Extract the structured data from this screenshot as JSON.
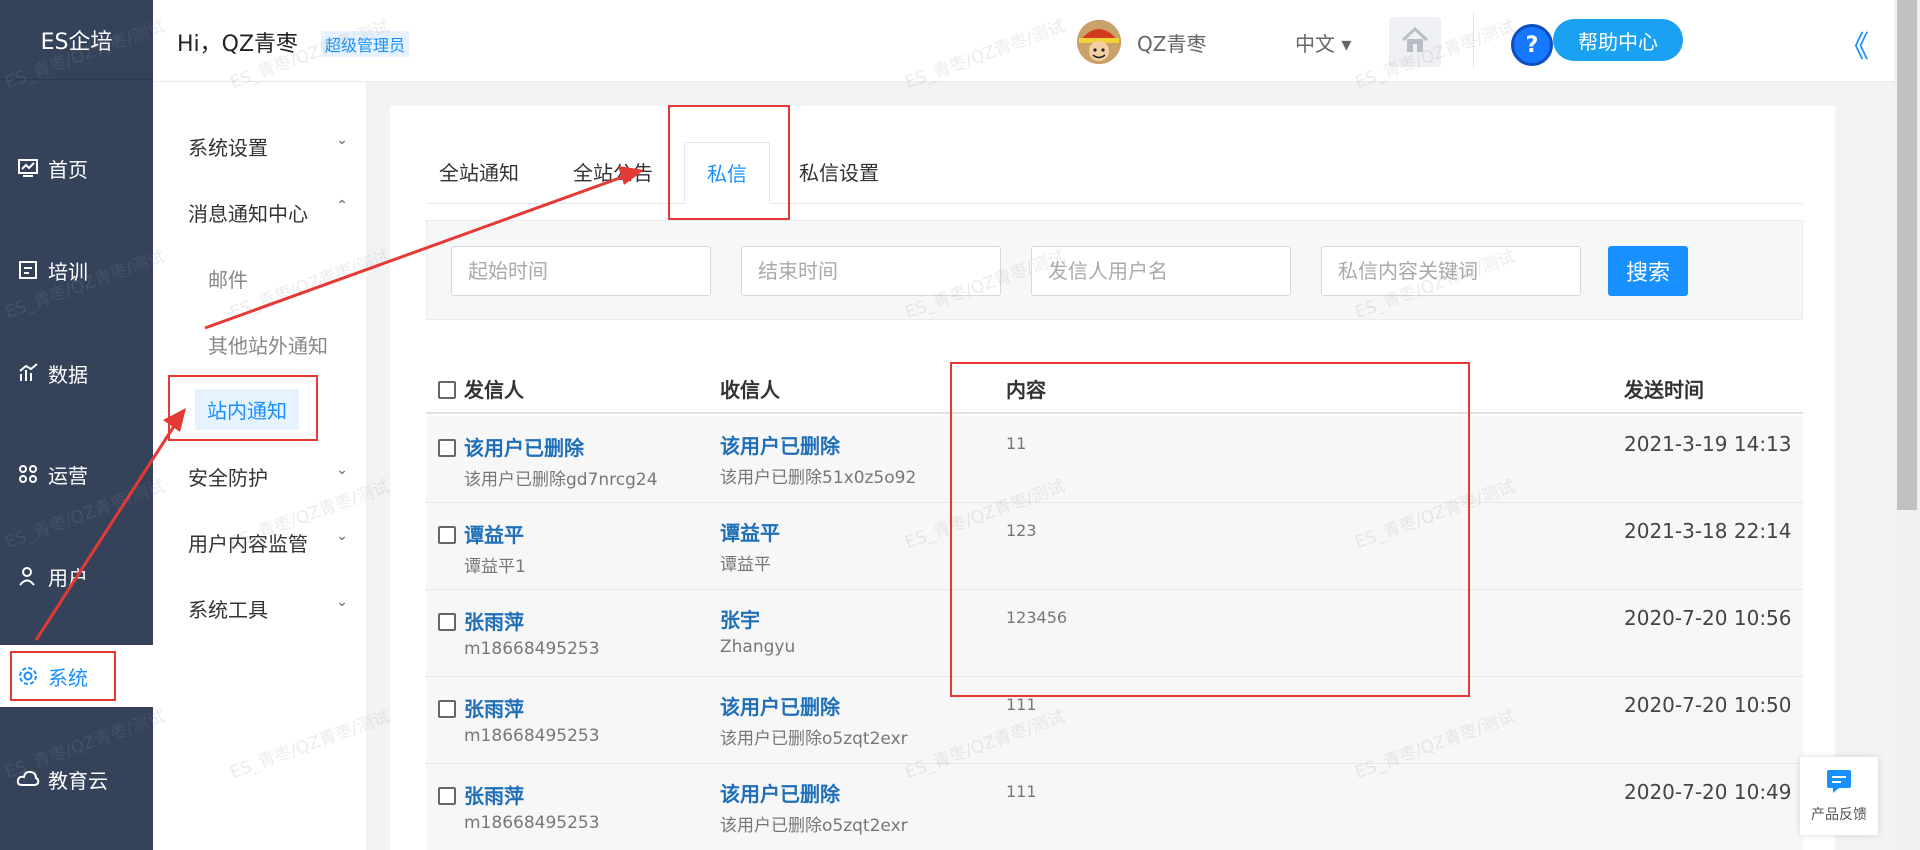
{
  "brand": "ES企培",
  "nav": {
    "items": [
      {
        "label": "首页",
        "icon": "dashboard-icon"
      },
      {
        "label": "培训",
        "icon": "training-icon"
      },
      {
        "label": "数据",
        "icon": "data-chart-icon"
      },
      {
        "label": "运营",
        "icon": "operation-icon"
      },
      {
        "label": "用户",
        "icon": "user-icon"
      },
      {
        "label": "系统",
        "icon": "gear-icon"
      },
      {
        "label": "教育云",
        "icon": "cloud-icon"
      }
    ]
  },
  "header": {
    "greeting": "Hi，QZ青枣",
    "role": "超级管理员",
    "username": "QZ青枣",
    "language": "中文 ▾",
    "help": "帮助中心",
    "help_q": "?",
    "collapse": "《"
  },
  "submenu": {
    "items": [
      {
        "label": "系统设置",
        "chev": "⌄"
      },
      {
        "label": "消息通知中心",
        "chev": "⌃"
      },
      {
        "label": "邮件"
      },
      {
        "label": "其他站外通知"
      },
      {
        "label": "站内通知"
      },
      {
        "label": "安全防护",
        "chev": "⌄"
      },
      {
        "label": "用户内容监管",
        "chev": "⌄"
      },
      {
        "label": "系统工具",
        "chev": "⌄"
      }
    ]
  },
  "tabs": [
    "全站通知",
    "全站公告",
    "私信",
    "私信设置"
  ],
  "filter": {
    "start_placeholder": "起始时间",
    "end_placeholder": "结束时间",
    "sender_placeholder": "发信人用户名",
    "keyword_placeholder": "私信内容关键词",
    "search_label": "搜索"
  },
  "table": {
    "columns": [
      "发信人",
      "收信人",
      "内容",
      "发送时间"
    ],
    "rows": [
      {
        "sender": "该用户已删除",
        "sender_sub": "该用户已删除gd7nrcg24",
        "receiver": "该用户已删除",
        "receiver_sub": "该用户已删除51x0z5o92",
        "content": "11",
        "time": "2021-3-19 14:13"
      },
      {
        "sender": "谭益平",
        "sender_sub": "谭益平1",
        "receiver": "谭益平",
        "receiver_sub": "谭益平",
        "content": "123",
        "time": "2021-3-18 22:14"
      },
      {
        "sender": "张雨萍",
        "sender_sub": "m18668495253",
        "receiver": "张宇",
        "receiver_sub": "Zhangyu",
        "content": "123456",
        "time": "2020-7-20 10:56"
      },
      {
        "sender": "张雨萍",
        "sender_sub": "m18668495253",
        "receiver": "该用户已删除",
        "receiver_sub": "该用户已删除o5zqt2exr",
        "content": "111",
        "time": "2020-7-20 10:50"
      },
      {
        "sender": "张雨萍",
        "sender_sub": "m18668495253",
        "receiver": "该用户已删除",
        "receiver_sub": "该用户已删除o5zqt2exr",
        "content": "111",
        "time": "2020-7-20 10:49"
      }
    ]
  },
  "feedback": "产品反馈",
  "watermark": "ES_青枣/QZ青枣/测试",
  "colors": {
    "accent": "#1890ff",
    "nav_bg": "#34425a",
    "annotation": "#e53935"
  }
}
